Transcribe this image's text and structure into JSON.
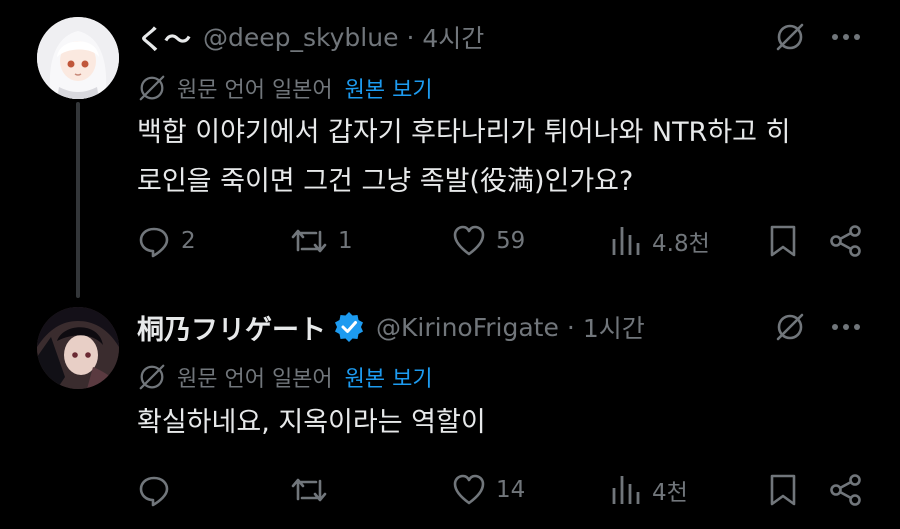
{
  "posts": [
    {
      "display_name": "く〜",
      "handle": "@deep_skyblue",
      "separator": "·",
      "time": "4시간",
      "translation_label": "원문 언어 일본어",
      "translation_link": "원본 보기",
      "text_lines": [
        "백합 이야기에서 갑자기 후타나리가 튀어나와 NTR하고 히",
        "로인을 죽이면 그건 그냥 족발(役満)인가요?"
      ],
      "stats": {
        "replies": "2",
        "reposts": "1",
        "likes": "59",
        "views": "4.8천"
      },
      "icons": [
        "grok-icon",
        "more-icon",
        "reply-icon",
        "repost-icon",
        "like-icon",
        "views-icon",
        "bookmark-icon",
        "share-icon"
      ]
    },
    {
      "display_name": "桐乃フリゲート",
      "verified": true,
      "handle": "@KirinoFrigate",
      "separator": "·",
      "time": "1시간",
      "translation_label": "원문 언어 일본어",
      "translation_link": "원본 보기",
      "text_lines": [
        "확실하네요, 지옥이라는 역할이"
      ],
      "stats": {
        "replies": "",
        "reposts": "",
        "likes": "14",
        "views": "4천"
      },
      "icons": [
        "grok-icon",
        "more-icon",
        "reply-icon",
        "repost-icon",
        "like-icon",
        "views-icon",
        "bookmark-icon",
        "share-icon"
      ]
    }
  ],
  "colors": {
    "background": "#000000",
    "text": "#e7e9ea",
    "muted": "#71767b",
    "link": "#1d9bf0",
    "verified": "#1d9bf0"
  }
}
